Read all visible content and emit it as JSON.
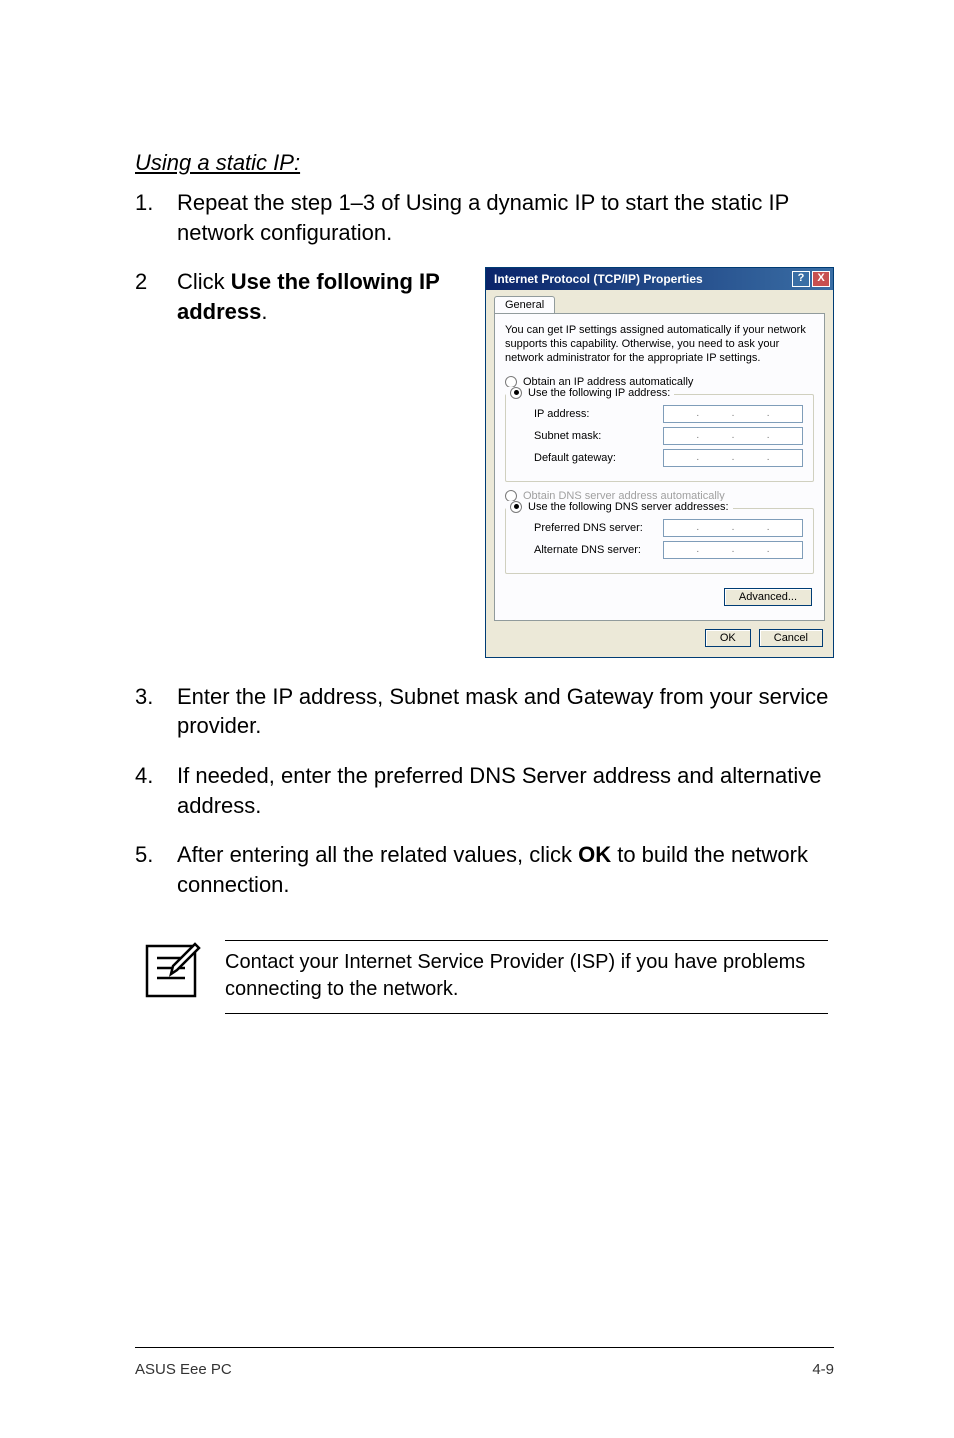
{
  "section_title": "Using a static IP:",
  "step1": {
    "num": "1.",
    "text": "Repeat the step 1–3 of Using a dynamic IP to start the static IP network configuration."
  },
  "step2": {
    "num": "2",
    "prefix": "Click ",
    "bold1": "Use the following IP address",
    "suffix": "."
  },
  "dialog": {
    "title": "Internet Protocol (TCP/IP) Properties",
    "help": "?",
    "close": "X",
    "tab": "General",
    "desc": "You can get IP settings assigned automatically if your network supports this capability. Otherwise, you need to ask your network administrator for the appropriate IP settings.",
    "radio_auto_ip": "Obtain an IP address automatically",
    "radio_static_ip": "Use the following IP address:",
    "ip_label": "IP address:",
    "subnet_label": "Subnet mask:",
    "gateway_label": "Default gateway:",
    "radio_auto_dns": "Obtain DNS server address automatically",
    "radio_static_dns": "Use the following DNS server addresses:",
    "pref_dns": "Preferred DNS server:",
    "alt_dns": "Alternate DNS server:",
    "advanced": "Advanced...",
    "ok": "OK",
    "cancel": "Cancel"
  },
  "step3": {
    "num": "3.",
    "text": "Enter the IP address, Subnet mask and Gateway from your service provider."
  },
  "step4": {
    "num": "4.",
    "text": "If needed, enter the preferred DNS Server address and alternative address."
  },
  "step5": {
    "num": "5.",
    "prefix": "After entering all the related values, click ",
    "bold": "OK",
    "suffix": " to build the network connection."
  },
  "note": "Contact your Internet Service Provider (ISP) if you have problems connecting to the network.",
  "footer_left": "ASUS Eee PC",
  "footer_right": "4-9"
}
